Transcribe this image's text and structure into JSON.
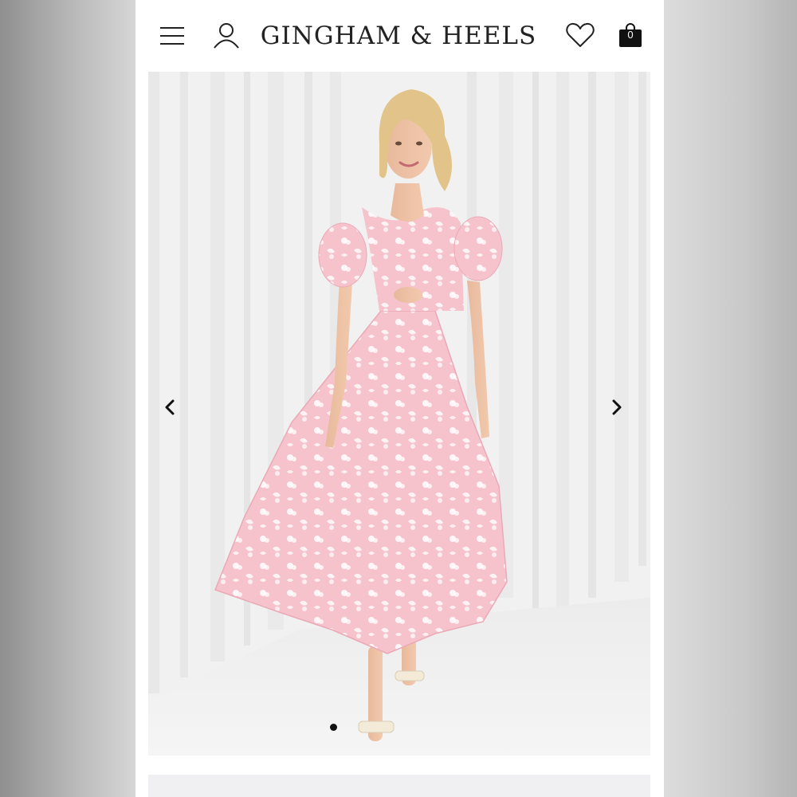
{
  "header": {
    "logo_text": "GINGHAM & HEELS",
    "cart_count": "0",
    "icons": {
      "menu": "hamburger-menu-icon",
      "account": "user-icon",
      "wishlist": "heart-icon",
      "cart": "shopping-bag-icon"
    }
  },
  "gallery": {
    "image": "product photo: model wearing pink floral organza midi dress with puff sleeves and cut-out bow bodice, white curtain backdrop",
    "prev_icon": "chevron-left-icon",
    "next_icon": "chevron-right-icon",
    "dots_count": 1,
    "active_dot": 0
  },
  "colors": {
    "dress_pink": "#f6c6cf",
    "accent_black": "#111111",
    "background": "#ffffff"
  }
}
